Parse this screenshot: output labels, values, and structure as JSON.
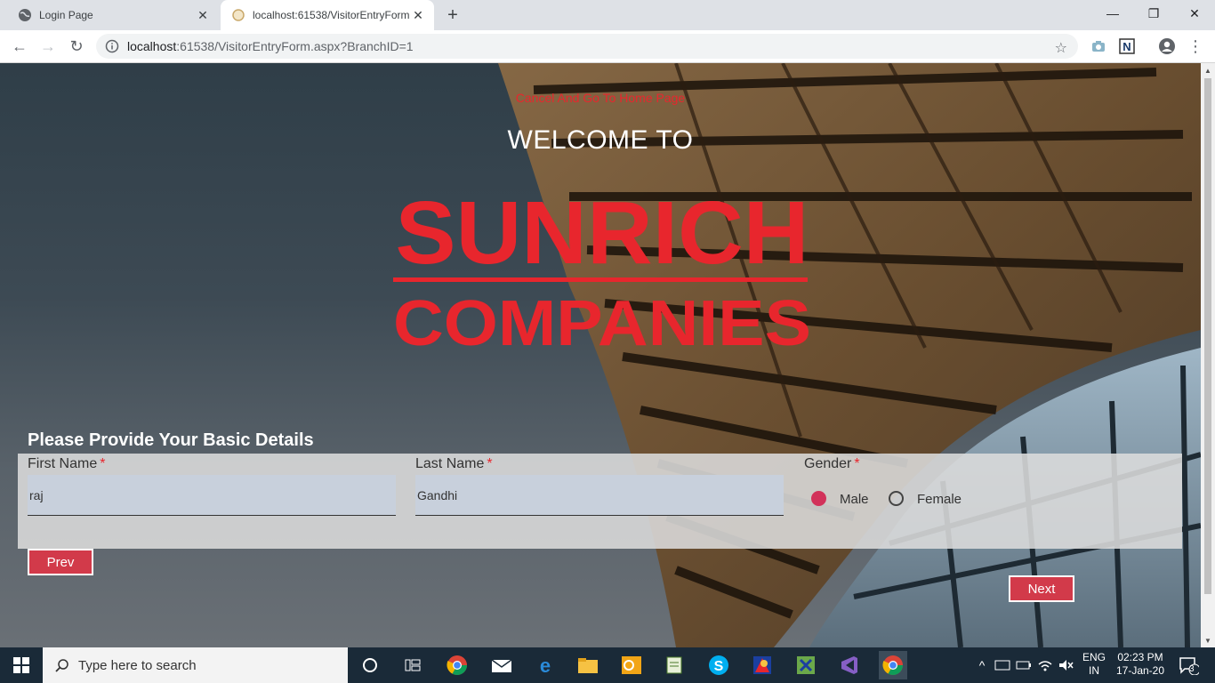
{
  "browser": {
    "tabs": [
      {
        "title": "Login Page",
        "active": false
      },
      {
        "title": "localhost:61538/VisitorEntryForm",
        "active": true
      }
    ],
    "url_host": "localhost",
    "url_rest": ":61538/VisitorEntryForm.aspx?BranchID=1"
  },
  "page": {
    "cancel_link": "Cancel And Go To Home Page",
    "welcome": "WELCOME TO",
    "logo_line1": "SUNRICH",
    "logo_line2": "COMPANIES",
    "section_title": "Please Provide Your Basic Details",
    "fields": {
      "first_name": {
        "label": "First Name",
        "required_mark": "*",
        "value": "raj"
      },
      "last_name": {
        "label": "Last Name",
        "required_mark": "*",
        "value": "Gandhi"
      },
      "gender": {
        "label": "Gender",
        "required_mark": "*",
        "options": [
          "Male",
          "Female"
        ],
        "selected": "Male"
      }
    },
    "prev_button": "Prev",
    "next_button": "Next"
  },
  "taskbar": {
    "search_placeholder": "Type here to search",
    "lang_top": "ENG",
    "lang_bottom": "IN",
    "time": "02:23 PM",
    "date": "17-Jan-20",
    "notification_count": "3"
  },
  "colors": {
    "brand_red": "#e8262d",
    "button_red": "#d23a4a",
    "radio_selected": "#d2325a"
  }
}
